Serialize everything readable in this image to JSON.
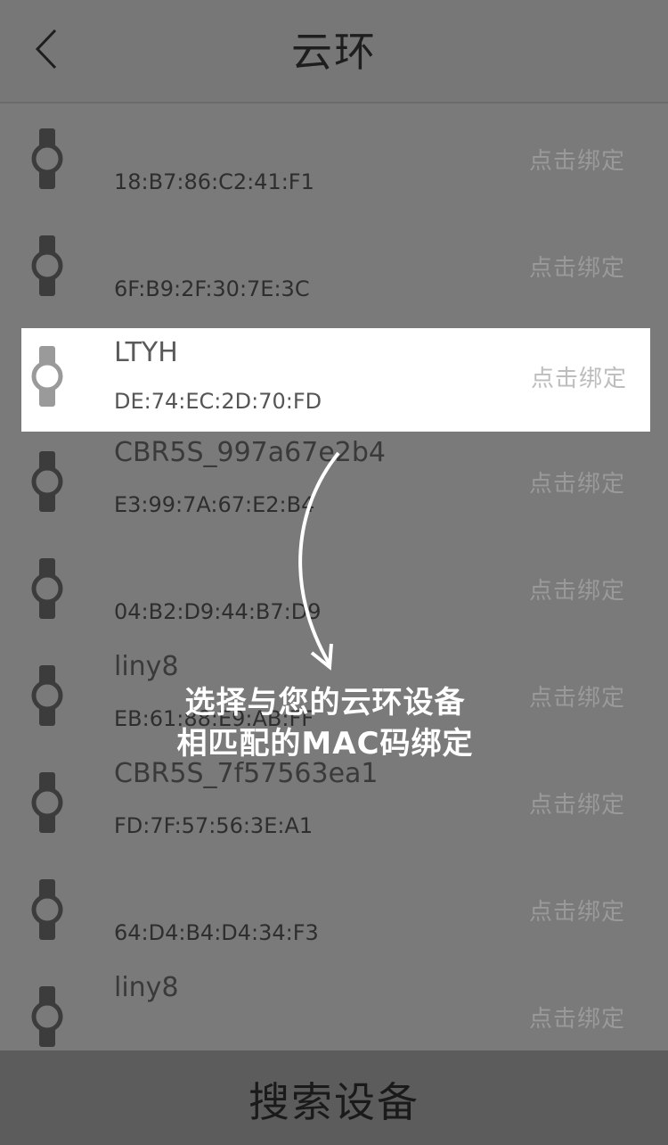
{
  "header": {
    "title": "云环"
  },
  "devices": [
    {
      "name": "",
      "mac": "18:B7:86:C2:41:F1",
      "action": "点击绑定"
    },
    {
      "name": "",
      "mac": "6F:B9:2F:30:7E:3C",
      "action": "点击绑定"
    },
    {
      "name": "LTYH",
      "mac": "DE:74:EC:2D:70:FD",
      "action": "点击绑定",
      "highlighted": true
    },
    {
      "name": "CBR5S_997a67e2b4",
      "mac": "E3:99:7A:67:E2:B4",
      "action": "点击绑定"
    },
    {
      "name": "",
      "mac": "04:B2:D9:44:B7:D9",
      "action": "点击绑定"
    },
    {
      "name": "liny8",
      "mac": "EB:61:88:E9:AB:FF",
      "action": "点击绑定"
    },
    {
      "name": "CBR5S_7f57563ea1",
      "mac": "FD:7F:57:56:3E:A1",
      "action": "点击绑定"
    },
    {
      "name": "",
      "mac": "64:D4:B4:D4:34:F3",
      "action": "点击绑定"
    },
    {
      "name": "liny8",
      "mac": "",
      "action": "点击绑定"
    }
  ],
  "guide": {
    "line1": "选择与您的云环设备",
    "line2": "相匹配的MAC码绑定"
  },
  "footer": {
    "search_label": "搜索设备"
  },
  "icons": {
    "back": "chevron-left-icon",
    "device": "watch-icon"
  },
  "colors": {
    "overlay": "#7a7a7a",
    "highlight": "#ffffff",
    "footer": "#5c5c5c"
  }
}
